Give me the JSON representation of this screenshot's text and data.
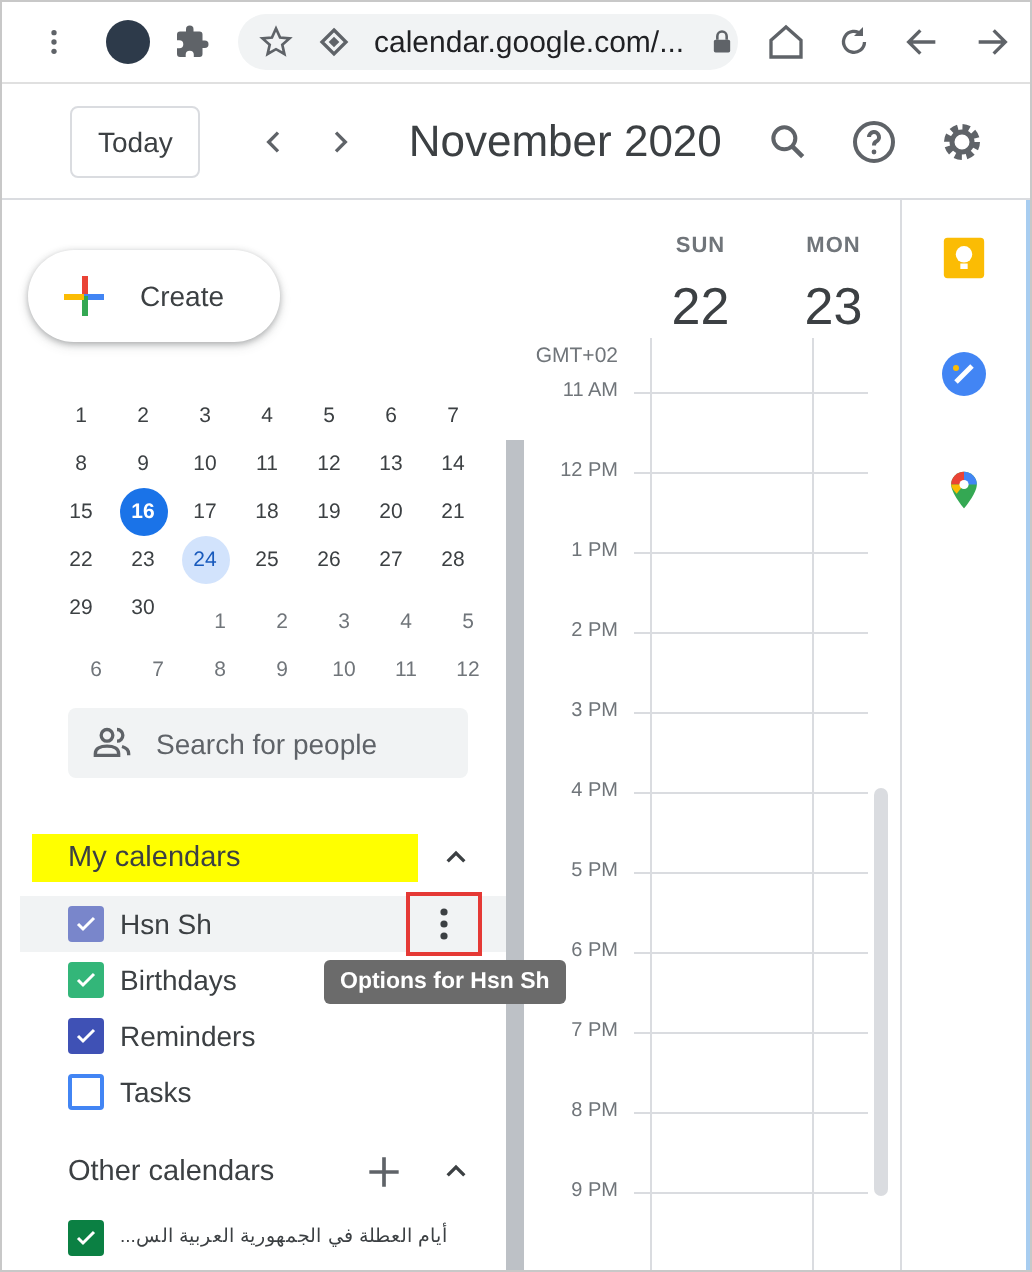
{
  "browser": {
    "url": "calendar.google.com/..."
  },
  "header": {
    "today_button": "Today",
    "title": "November 2020"
  },
  "sidebar": {
    "create_button": "Create",
    "mini_calendar": {
      "days": [
        {
          "label": "1",
          "other_month": false,
          "today": false,
          "selected": false
        },
        {
          "label": "2",
          "other_month": false,
          "today": false,
          "selected": false
        },
        {
          "label": "3",
          "other_month": false,
          "today": false,
          "selected": false
        },
        {
          "label": "4",
          "other_month": false,
          "today": false,
          "selected": false
        },
        {
          "label": "5",
          "other_month": false,
          "today": false,
          "selected": false
        },
        {
          "label": "6",
          "other_month": false,
          "today": false,
          "selected": false
        },
        {
          "label": "7",
          "other_month": false,
          "today": false,
          "selected": false
        },
        {
          "label": "8",
          "other_month": false,
          "today": false,
          "selected": false
        },
        {
          "label": "9",
          "other_month": false,
          "today": false,
          "selected": false
        },
        {
          "label": "10",
          "other_month": false,
          "today": false,
          "selected": false
        },
        {
          "label": "11",
          "other_month": false,
          "today": false,
          "selected": false
        },
        {
          "label": "12",
          "other_month": false,
          "today": false,
          "selected": false
        },
        {
          "label": "13",
          "other_month": false,
          "today": false,
          "selected": false
        },
        {
          "label": "14",
          "other_month": false,
          "today": false,
          "selected": false
        },
        {
          "label": "15",
          "other_month": false,
          "today": false,
          "selected": false
        },
        {
          "label": "16",
          "other_month": false,
          "today": true,
          "selected": false
        },
        {
          "label": "17",
          "other_month": false,
          "today": false,
          "selected": false
        },
        {
          "label": "18",
          "other_month": false,
          "today": false,
          "selected": false
        },
        {
          "label": "19",
          "other_month": false,
          "today": false,
          "selected": false
        },
        {
          "label": "20",
          "other_month": false,
          "today": false,
          "selected": false
        },
        {
          "label": "21",
          "other_month": false,
          "today": false,
          "selected": false
        },
        {
          "label": "22",
          "other_month": false,
          "today": false,
          "selected": false
        },
        {
          "label": "23",
          "other_month": false,
          "today": false,
          "selected": false
        },
        {
          "label": "24",
          "other_month": false,
          "today": false,
          "selected": true
        },
        {
          "label": "25",
          "other_month": false,
          "today": false,
          "selected": false
        },
        {
          "label": "26",
          "other_month": false,
          "today": false,
          "selected": false
        },
        {
          "label": "27",
          "other_month": false,
          "today": false,
          "selected": false
        },
        {
          "label": "28",
          "other_month": false,
          "today": false,
          "selected": false
        },
        {
          "label": "29",
          "other_month": false,
          "today": false,
          "selected": false
        },
        {
          "label": "30",
          "other_month": false,
          "today": false,
          "selected": false
        },
        {
          "label": "1",
          "other_month": true,
          "today": false,
          "selected": false
        },
        {
          "label": "2",
          "other_month": true,
          "today": false,
          "selected": false
        },
        {
          "label": "3",
          "other_month": true,
          "today": false,
          "selected": false
        },
        {
          "label": "4",
          "other_month": true,
          "today": false,
          "selected": false
        },
        {
          "label": "5",
          "other_month": true,
          "today": false,
          "selected": false
        },
        {
          "label": "6",
          "other_month": true,
          "today": false,
          "selected": false
        },
        {
          "label": "7",
          "other_month": true,
          "today": false,
          "selected": false
        },
        {
          "label": "8",
          "other_month": true,
          "today": false,
          "selected": false
        },
        {
          "label": "9",
          "other_month": true,
          "today": false,
          "selected": false
        },
        {
          "label": "10",
          "other_month": true,
          "today": false,
          "selected": false
        },
        {
          "label": "11",
          "other_month": true,
          "today": false,
          "selected": false
        },
        {
          "label": "12",
          "other_month": true,
          "today": false,
          "selected": false
        }
      ]
    },
    "search": {
      "placeholder": "Search for people"
    },
    "my_calendars": {
      "title": "My calendars",
      "highlighted": true,
      "expanded": true,
      "items": [
        {
          "name": "Hsn Sh",
          "checked": true,
          "color": "#7986cb",
          "hovered": true,
          "options_marked": true,
          "tooltip": "Options for Hsn Sh"
        },
        {
          "name": "Birthdays",
          "checked": true,
          "color": "#33b679",
          "hovered": false
        },
        {
          "name": "Reminders",
          "checked": true,
          "color": "#3f51b5",
          "hovered": false
        },
        {
          "name": "Tasks",
          "checked": false,
          "color": "#4285f4",
          "hovered": false
        }
      ]
    },
    "other_calendars": {
      "title": "Other calendars",
      "highlighted": false,
      "expanded": true,
      "items": [
        {
          "name": "أيام العطلة في الجمهورية العربية الس...",
          "checked": true,
          "color": "#0b8043",
          "hovered": false
        }
      ]
    }
  },
  "week": {
    "days": [
      {
        "weekday": "SUN",
        "date": "22"
      },
      {
        "weekday": "MON",
        "date": "23"
      }
    ],
    "timezone": "GMT+02",
    "hours": [
      "11 AM",
      "12 PM",
      "1 PM",
      "2 PM",
      "3 PM",
      "4 PM",
      "5 PM",
      "6 PM",
      "7 PM",
      "8 PM",
      "9 PM"
    ]
  }
}
